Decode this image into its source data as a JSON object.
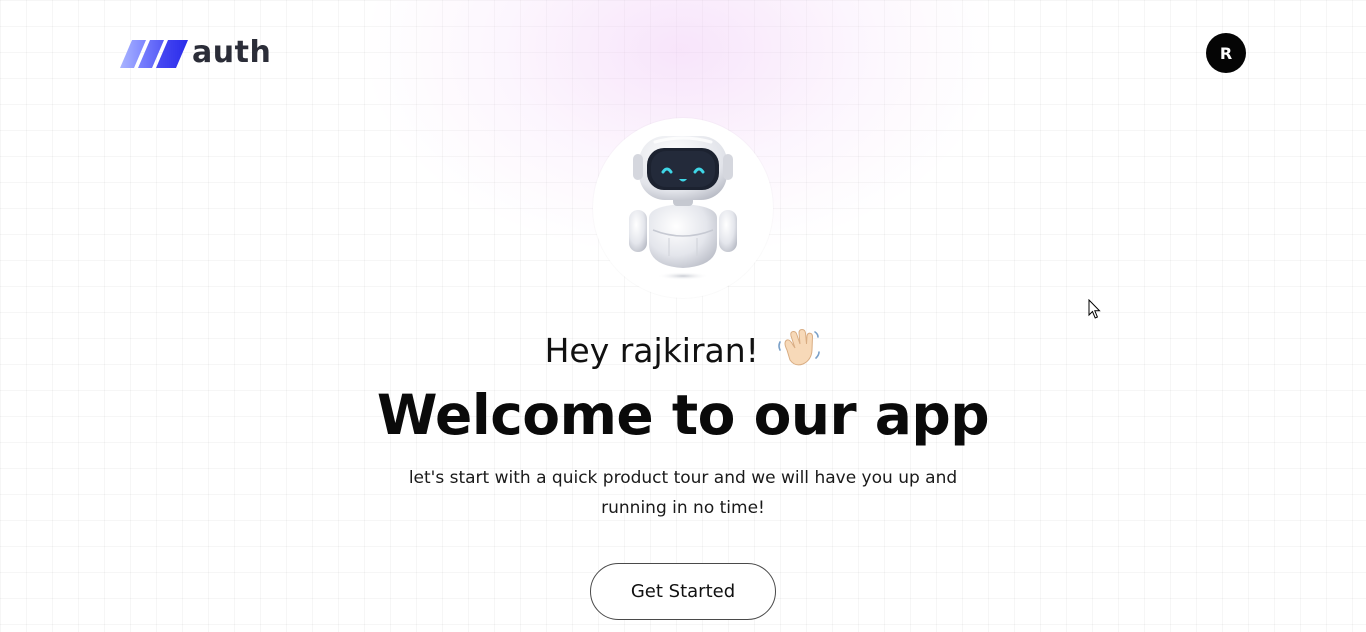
{
  "header": {
    "logo_text": "auth",
    "avatar_initial": "R"
  },
  "hero": {
    "greeting": "Hey rajkiran!",
    "greeting_icon": "waving-hand-icon",
    "headline": "Welcome to our app",
    "subtitle": "let's start with a quick product tour and we will have you up and running in no time!",
    "illustration": "robot-icon"
  },
  "cta": {
    "label": "Get Started"
  },
  "colors": {
    "brand_blue": "#3a3bf0",
    "brand_blue_light": "#8f9cff",
    "avatar_bg": "#050505",
    "text_dark": "#0a0a0a",
    "glow_pink": "#eec4f5",
    "robot_eye": "#3fd6e6"
  }
}
